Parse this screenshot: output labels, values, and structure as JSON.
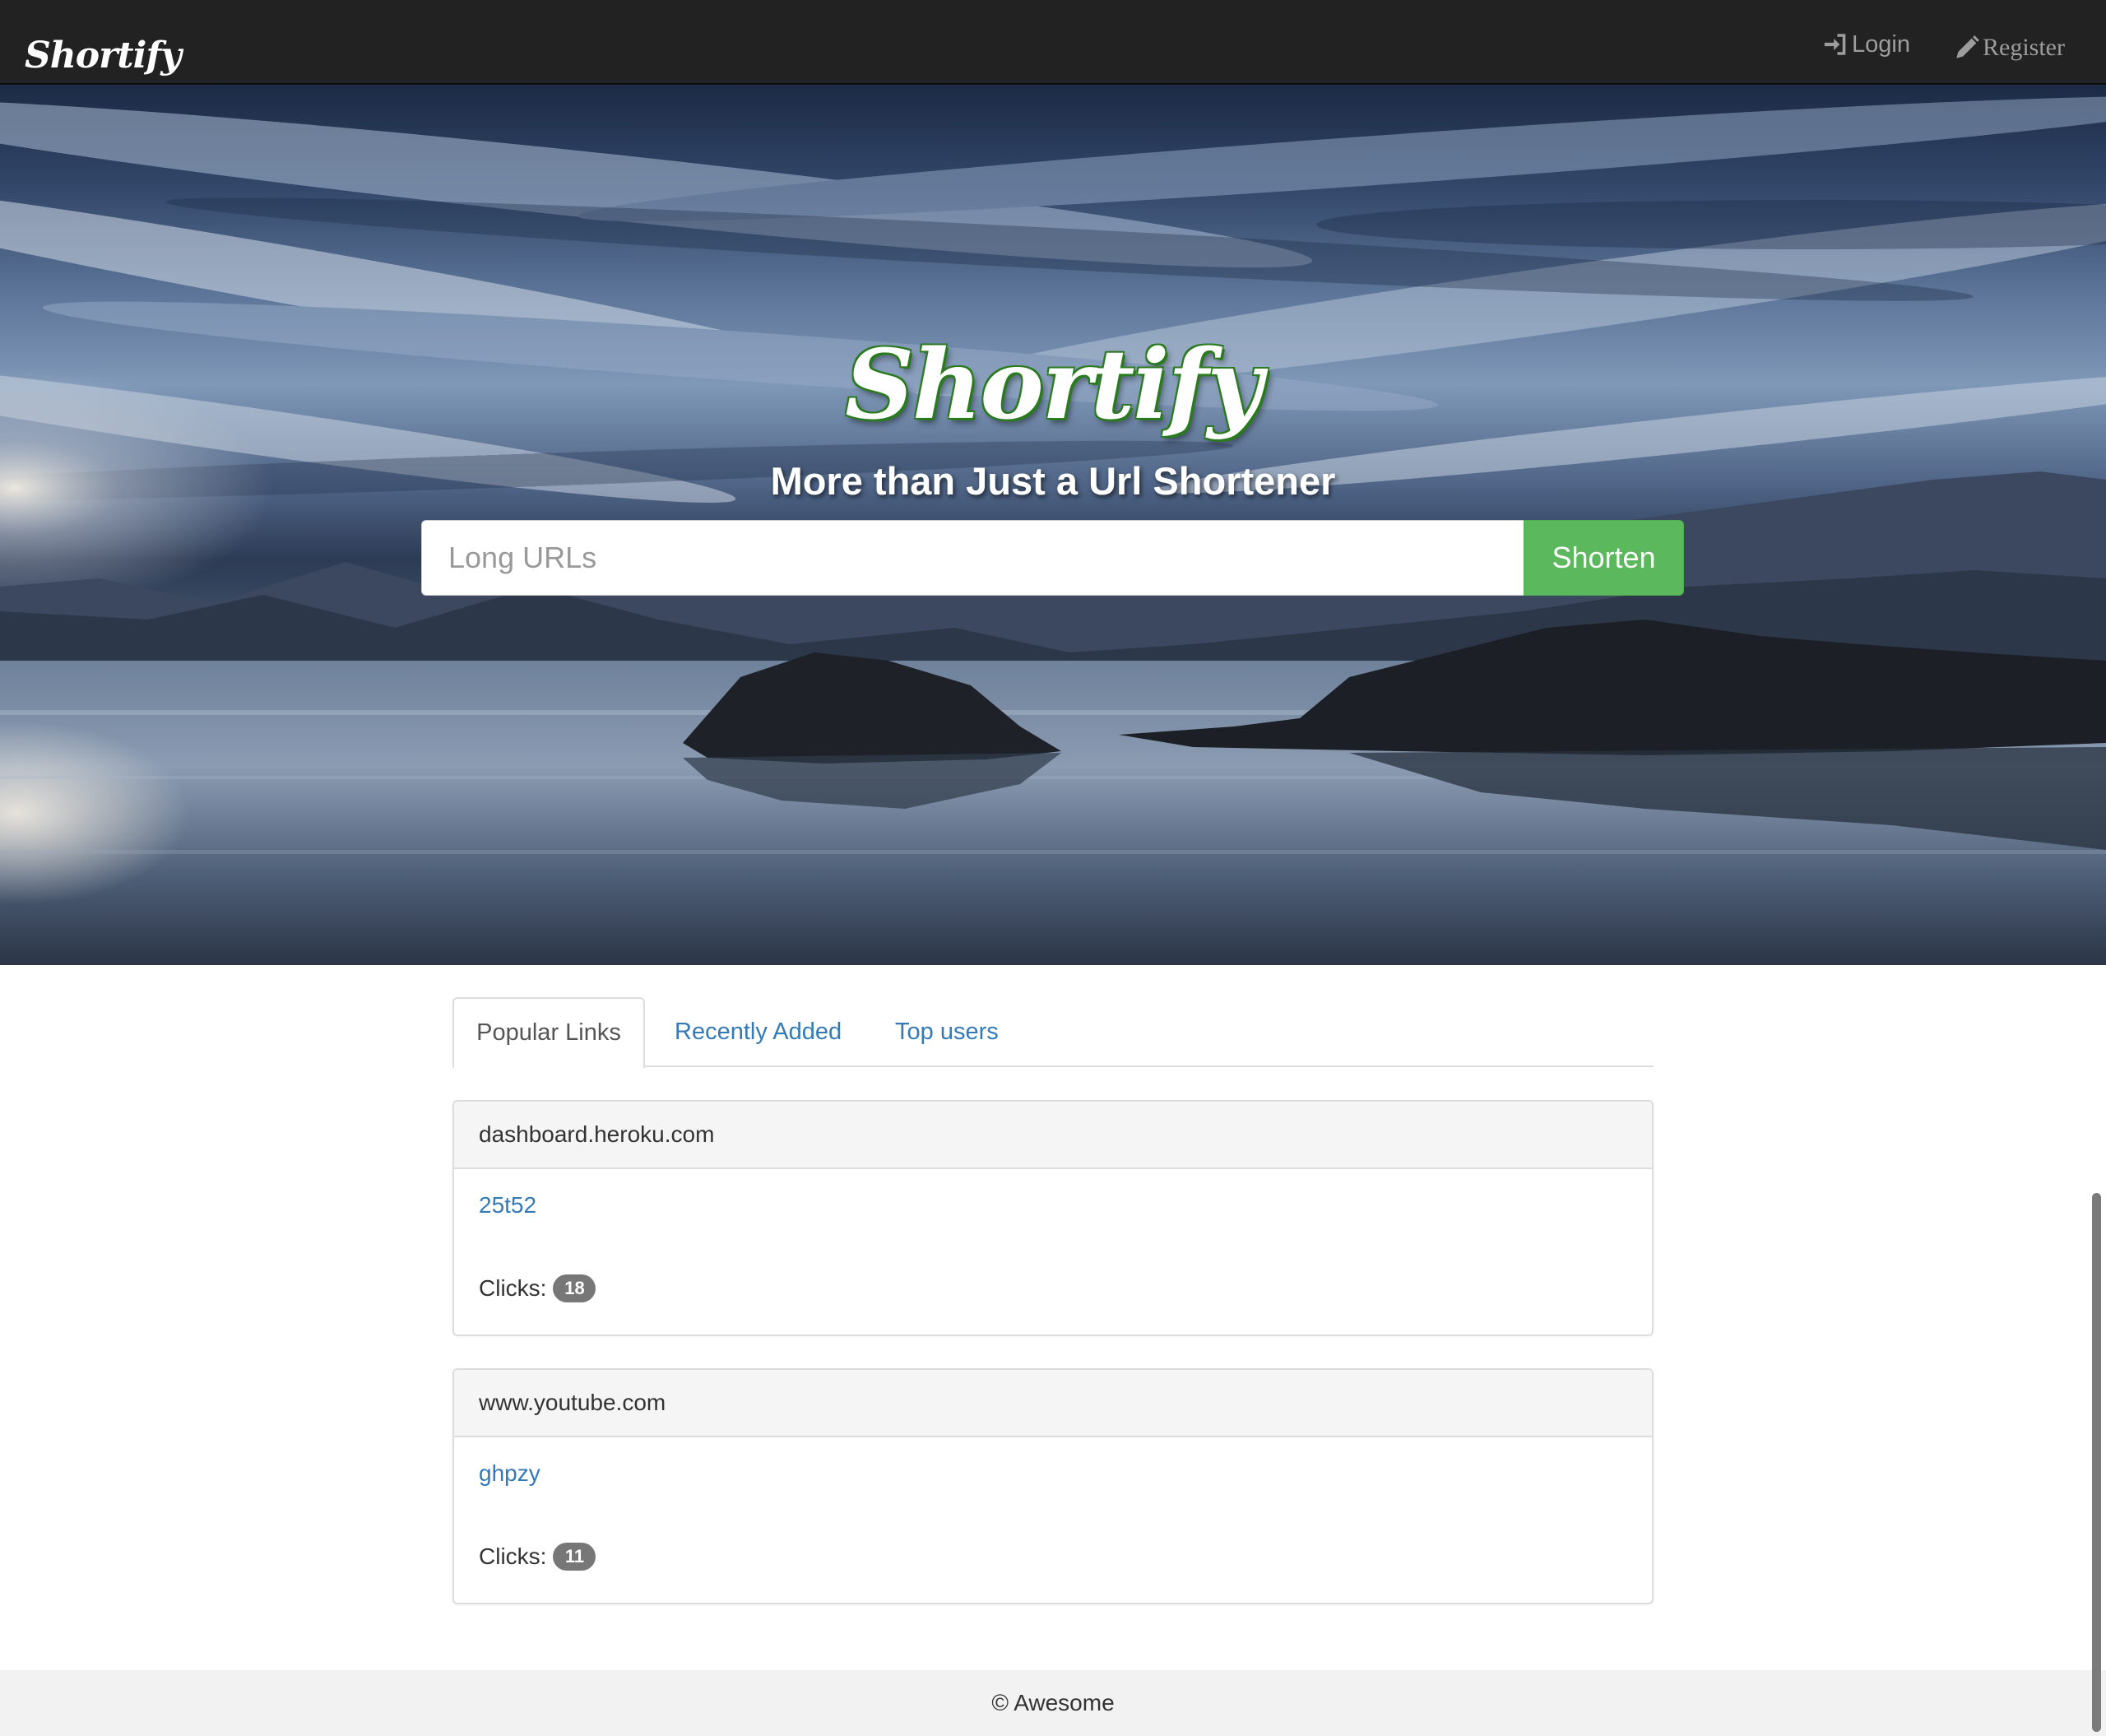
{
  "navbar": {
    "brand": "Shortify",
    "login_label": "Login",
    "register_label": "Register",
    "login_icon": "sign-in-icon",
    "register_icon": "pencil-icon"
  },
  "hero": {
    "title": "Shortify",
    "subtitle": "More than Just a Url Shortener",
    "input_placeholder": "Long URLs",
    "input_value": "",
    "button_label": "Shorten"
  },
  "tabs": [
    {
      "label": "Popular Links",
      "active": true
    },
    {
      "label": "Recently Added",
      "active": false
    },
    {
      "label": "Top users",
      "active": false
    }
  ],
  "links": [
    {
      "domain": "dashboard.heroku.com",
      "short_code": "25t52",
      "clicks_label": "Clicks:",
      "clicks": "18"
    },
    {
      "domain": "www.youtube.com",
      "short_code": "ghpzy",
      "clicks_label": "Clicks:",
      "clicks": "11"
    }
  ],
  "footer": {
    "text": "© Awesome"
  },
  "colors": {
    "navbar_bg": "#222222",
    "nav_text": "#9d9d9d",
    "accent_green": "#5cb85c",
    "link_blue": "#337ab7",
    "badge_gray": "#777777",
    "footer_bg": "#f2f2f2"
  }
}
